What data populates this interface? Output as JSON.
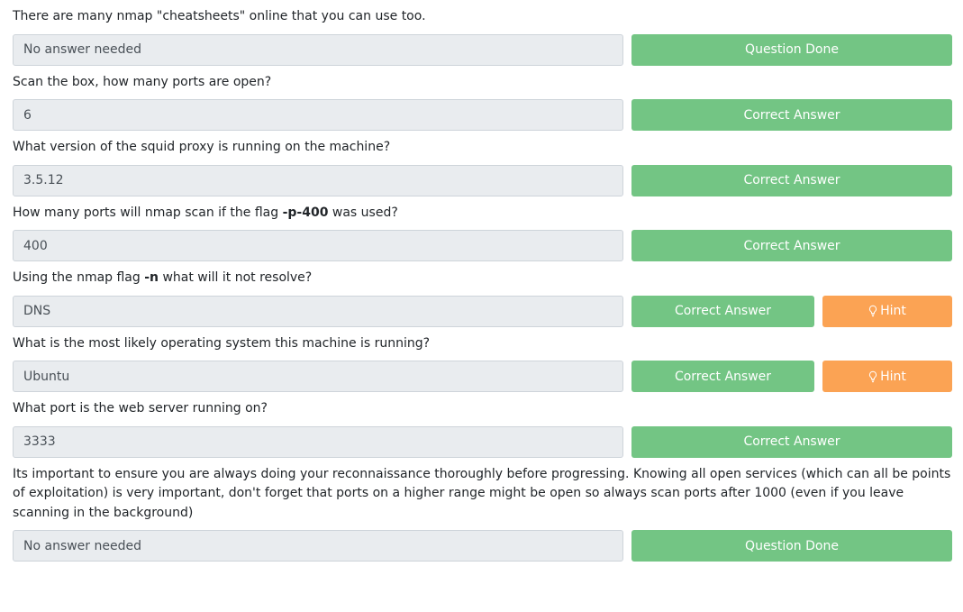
{
  "questions": [
    {
      "text": "There are many nmap \"cheatsheets\" online that you can use too.",
      "answer": "No answer needed",
      "button": "Question Done",
      "hint": null
    },
    {
      "text": "Scan the box, how many ports are open?",
      "answer": "6",
      "button": "Correct Answer",
      "hint": null
    },
    {
      "text": "What version of the squid proxy is running on the machine?",
      "answer": "3.5.12",
      "button": "Correct Answer",
      "hint": null
    },
    {
      "text_before": "How many ports will nmap scan if the flag ",
      "text_flag": "-p-400",
      "text_after": " was used?",
      "answer": "400",
      "button": "Correct Answer",
      "hint": null
    },
    {
      "text_before": "Using the nmap flag ",
      "text_flag": "-n",
      "text_after": " what will it not resolve?",
      "answer": "DNS",
      "button": "Correct Answer",
      "hint": "Hint"
    },
    {
      "text": "What is the most likely operating system this machine is running?",
      "answer": "Ubuntu",
      "button": "Correct Answer",
      "hint": "Hint"
    },
    {
      "text": "What port is the web server running on?",
      "answer": "3333",
      "button": "Correct Answer",
      "hint": null
    },
    {
      "text": "Its important to ensure you are always doing your reconnaissance thoroughly before progressing. Knowing all open services (which can all be points of exploitation) is very important, don't forget that ports on a higher range might be open so always scan ports after 1000 (even if you leave scanning in the background)",
      "answer": "No answer needed",
      "button": "Question Done",
      "hint": null
    }
  ],
  "icons": {
    "hint_icon": "lightbulb-icon"
  },
  "colors": {
    "success": "#73c584",
    "hint": "#fba354",
    "input_bg": "#e9ecef"
  }
}
